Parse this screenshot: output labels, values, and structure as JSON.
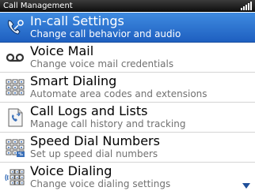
{
  "window": {
    "title": "Call Management"
  },
  "menu": {
    "items": [
      {
        "label": "In-call Settings",
        "description": "Change call behavior and audio",
        "icon": "phone-settings-icon",
        "selected": true
      },
      {
        "label": "Voice Mail",
        "description": "Change voice mail credentials",
        "icon": "voicemail-icon",
        "selected": false
      },
      {
        "label": "Smart Dialing",
        "description": "Automate area codes and extensions",
        "icon": "dialpad-icon",
        "selected": false
      },
      {
        "label": "Call Logs and Lists",
        "description": "Manage call history and tracking",
        "icon": "call-log-icon",
        "selected": false
      },
      {
        "label": "Speed Dial Numbers",
        "description": "Set up speed dial numbers",
        "icon": "speed-dial-icon",
        "selected": false
      },
      {
        "label": "Voice Dialing",
        "description": "Change voice dialing settings",
        "icon": "voice-dialing-icon",
        "selected": false
      }
    ]
  },
  "colors": {
    "selection": "#2f78d6",
    "titlebar": "#222222"
  }
}
